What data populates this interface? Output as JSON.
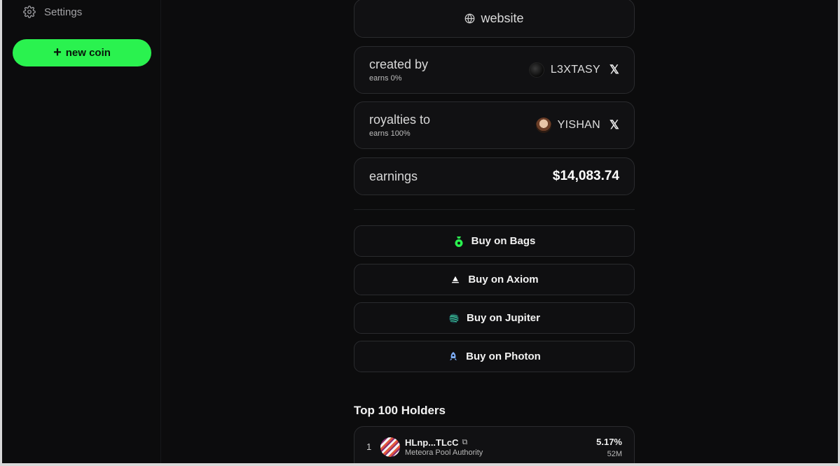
{
  "sidebar": {
    "settings_label": "Settings",
    "new_coin_label": "new coin"
  },
  "token": {
    "website_label": "website",
    "created_by": {
      "label": "created by",
      "sub": "earns 0%",
      "user": "L3XTASY"
    },
    "royalties_to": {
      "label": "royalties to",
      "sub": "earns 100%",
      "user": "YISHAN"
    },
    "earnings": {
      "label": "earnings",
      "value": "$14,083.74"
    }
  },
  "buy_buttons": [
    {
      "label": "Buy on Bags",
      "icon": "money-bag-icon",
      "color": "#2af24f"
    },
    {
      "label": "Buy on Axiom",
      "icon": "triangle-icon",
      "color": "#ffffff"
    },
    {
      "label": "Buy on Jupiter",
      "icon": "jupiter-icon",
      "color": "#3fd0a0"
    },
    {
      "label": "Buy on Photon",
      "icon": "rocket-icon",
      "color": "#7fb0ff"
    }
  ],
  "holders": {
    "title": "Top 100 Holders",
    "rows": [
      {
        "rank": "1",
        "address": "HLnp...TLcC",
        "name": "Meteora Pool Authority",
        "percent": "5.17%",
        "amount": "52M"
      }
    ]
  },
  "colors": {
    "accent": "#2af24f",
    "background": "#0c0c0d",
    "panel": "#111113",
    "border": "#2a2b2e"
  }
}
